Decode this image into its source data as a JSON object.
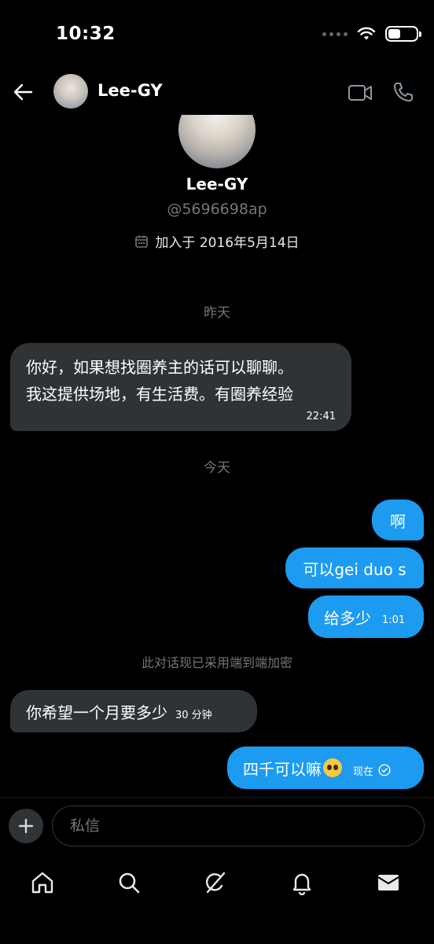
{
  "status": {
    "time": "10:32",
    "battery_level": 0.45
  },
  "header": {
    "name": "Lee-GY"
  },
  "profile": {
    "name": "Lee-GY",
    "handle": "@5696698ap",
    "joined": "加入于 2016年5月14日"
  },
  "conversation": {
    "sep_yesterday": "昨天",
    "msg1": {
      "line1": "你好，如果想找圈养主的话可以聊聊。",
      "line2": "我这提供场地，有生活费。有圈养经验",
      "time": "22:41"
    },
    "sep_today": "今天",
    "out1": {
      "text": "啊"
    },
    "out2": {
      "text": "可以gei duo s"
    },
    "out3": {
      "text": "给多少",
      "time": "1:01"
    },
    "encryption_note": "此对话现已采用端到端加密",
    "msg2": {
      "text": "你希望一个月要多少",
      "time": "30 分钟"
    },
    "out4": {
      "text": "四千可以嘛",
      "time": "现在"
    }
  },
  "composer": {
    "placeholder": "私信"
  },
  "colors": {
    "accent": "#1d9bf0",
    "incoming_bubble": "#2f3336",
    "muted_text": "#71767b"
  },
  "tabs": [
    "home-icon",
    "search-icon",
    "grok-icon",
    "notifications-icon",
    "messages-icon"
  ]
}
